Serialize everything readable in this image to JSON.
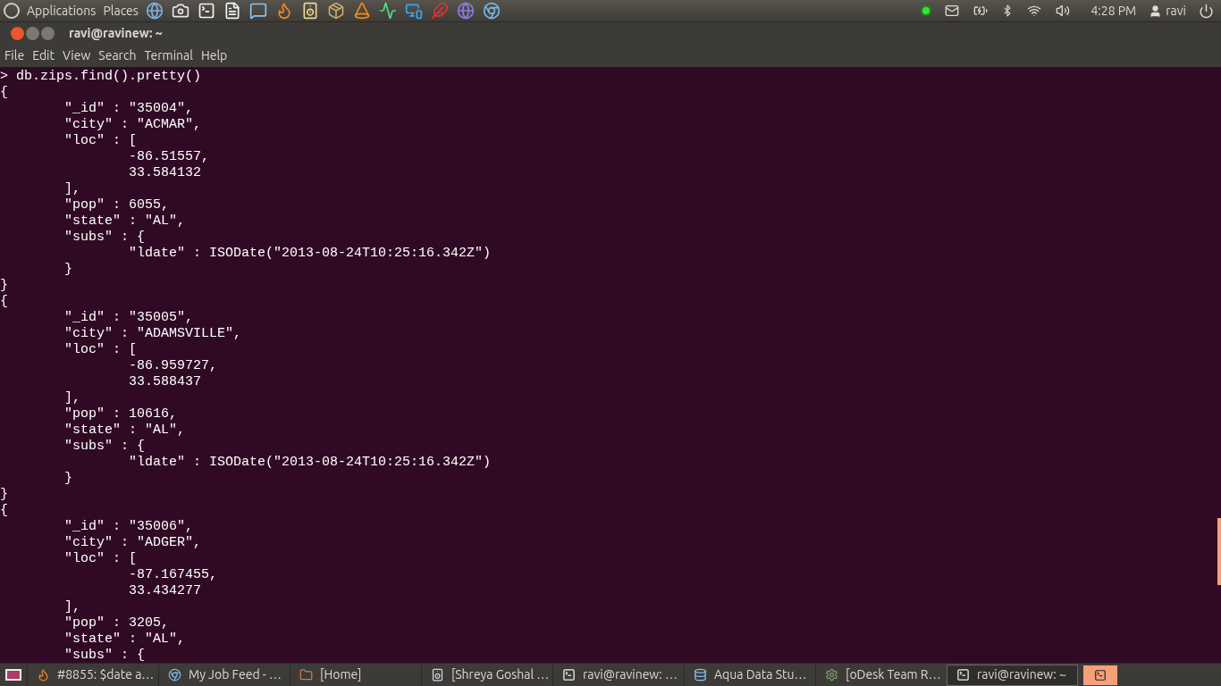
{
  "top_panel": {
    "menus": [
      "Applications",
      "Places"
    ],
    "clock": "4:28 PM",
    "user": "ravi"
  },
  "window": {
    "title": "ravi@ravinew: ~"
  },
  "menu_bar": [
    "File",
    "Edit",
    "View",
    "Search",
    "Terminal",
    "Help"
  ],
  "terminal": {
    "lines": [
      "> db.zips.find().pretty()",
      "{",
      "        \"_id\" : \"35004\",",
      "        \"city\" : \"ACMAR\",",
      "        \"loc\" : [",
      "                -86.51557,",
      "                33.584132",
      "        ],",
      "        \"pop\" : 6055,",
      "        \"state\" : \"AL\",",
      "        \"subs\" : {",
      "                \"ldate\" : ISODate(\"2013-08-24T10:25:16.342Z\")",
      "        }",
      "}",
      "{",
      "        \"_id\" : \"35005\",",
      "        \"city\" : \"ADAMSVILLE\",",
      "        \"loc\" : [",
      "                -86.959727,",
      "                33.588437",
      "        ],",
      "        \"pop\" : 10616,",
      "        \"state\" : \"AL\",",
      "        \"subs\" : {",
      "                \"ldate\" : ISODate(\"2013-08-24T10:25:16.342Z\")",
      "        }",
      "}",
      "{",
      "        \"_id\" : \"35006\",",
      "        \"city\" : \"ADGER\",",
      "        \"loc\" : [",
      "                -87.167455,",
      "                33.434277",
      "        ],",
      "        \"pop\" : 3205,",
      "        \"state\" : \"AL\",",
      "        \"subs\" : {"
    ]
  },
  "taskbar": {
    "items": [
      {
        "label": "#8855: $date a…",
        "selected": false
      },
      {
        "label": "My Job Feed - …",
        "selected": false
      },
      {
        "label": "[Home]",
        "selected": false
      },
      {
        "label": "[Shreya Goshal …",
        "selected": false
      },
      {
        "label": "ravi@ravinew: …",
        "selected": false
      },
      {
        "label": "Aqua Data Stu…",
        "selected": false
      },
      {
        "label": "[oDesk Team R…",
        "selected": false
      },
      {
        "label": "ravi@ravinew: ~",
        "selected": true
      }
    ]
  }
}
